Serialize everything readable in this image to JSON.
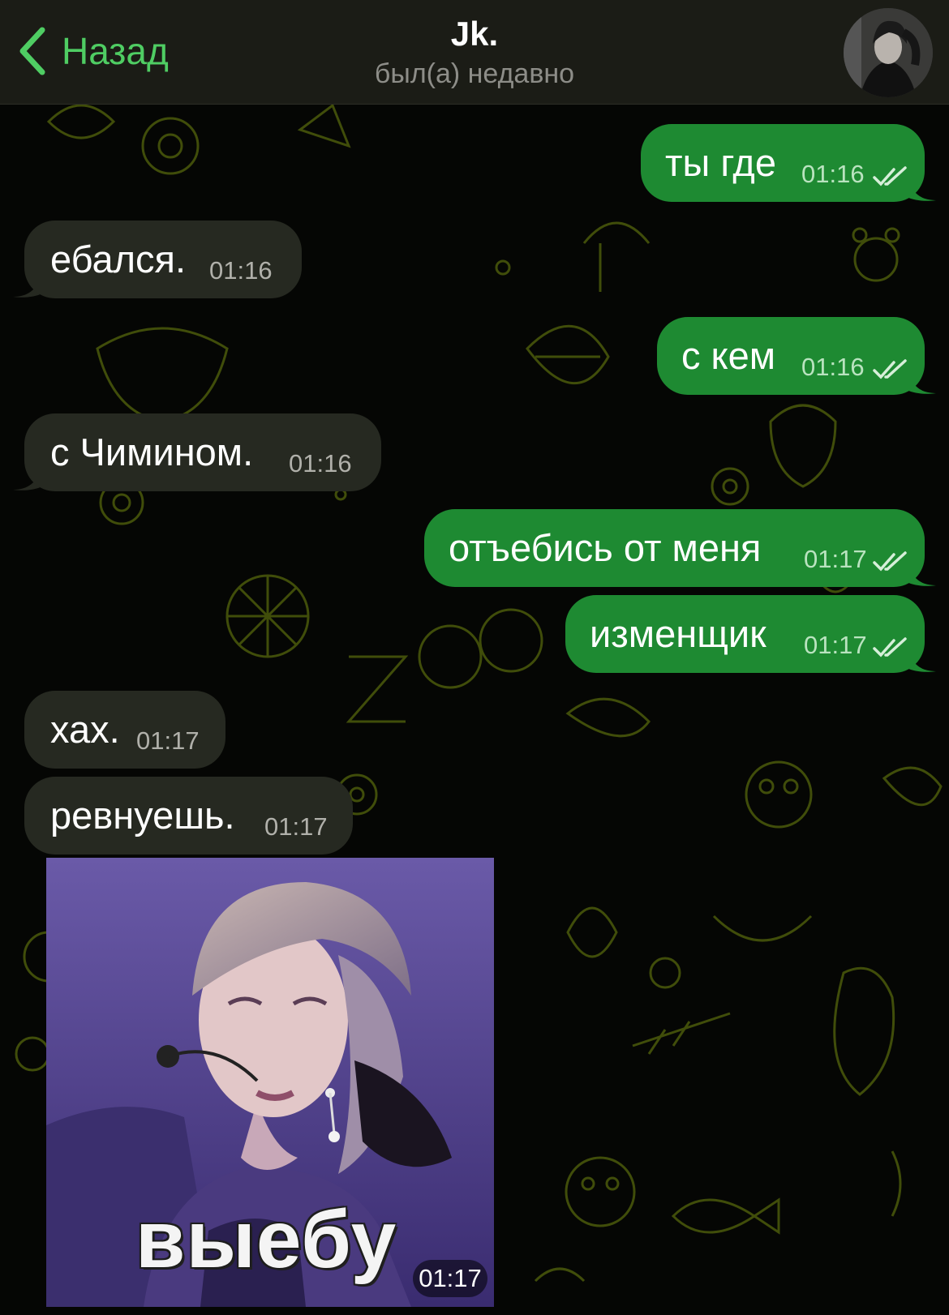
{
  "header": {
    "back_label": "Назад",
    "contact_name": "Jk.",
    "status": "был(а) недавно"
  },
  "colors": {
    "accent_green": "#4fcd63",
    "outgoing_bubble": "#1e8a32",
    "incoming_bubble": "#262921",
    "wallpaper_lines": "#5a6a10"
  },
  "messages": [
    {
      "direction": "out",
      "text": "ты где",
      "time": "01:16",
      "read": true
    },
    {
      "direction": "in",
      "text": "ебался.",
      "time": "01:16"
    },
    {
      "direction": "out",
      "text": "с кем",
      "time": "01:16",
      "read": true
    },
    {
      "direction": "in",
      "text": "с Чимином.",
      "time": "01:16"
    },
    {
      "direction": "out",
      "text": "отъебись от меня",
      "time": "01:17",
      "read": true
    },
    {
      "direction": "out",
      "text": "изменщик",
      "time": "01:17",
      "read": true
    },
    {
      "direction": "in",
      "text": "хах.",
      "time": "01:17"
    },
    {
      "direction": "in",
      "text": "ревнуешь.",
      "time": "01:17"
    }
  ],
  "sticker": {
    "caption": "выебу",
    "time": "01:17"
  },
  "icons": {
    "back": "chevron-left-icon",
    "read_receipt": "double-check-icon",
    "avatar": "contact-avatar"
  }
}
